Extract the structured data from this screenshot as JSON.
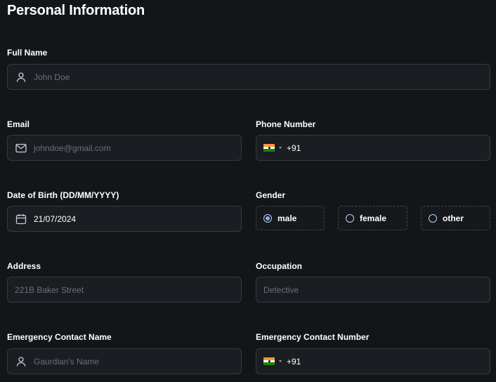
{
  "form": {
    "title": "Personal Information",
    "full_name": {
      "label": "Full Name",
      "placeholder": "John Doe"
    },
    "email": {
      "label": "Email",
      "placeholder": "johndoe@gmail.com"
    },
    "phone": {
      "label": "Phone Number",
      "value": "+91",
      "flag_icon": "india-flag-icon"
    },
    "dob": {
      "label": "Date of Birth (DD/MM/YYYY)",
      "value": "21/07/2024"
    },
    "gender": {
      "label": "Gender",
      "options": [
        {
          "label": "male",
          "selected": true
        },
        {
          "label": "female",
          "selected": false
        },
        {
          "label": "other",
          "selected": false
        }
      ]
    },
    "address": {
      "label": "Address",
      "placeholder": "221B Baker Street"
    },
    "occupation": {
      "label": "Occupation",
      "placeholder": "Detective"
    },
    "emergency_name": {
      "label": "Emergency Contact Name",
      "placeholder": "Gaurdian's Name"
    },
    "emergency_number": {
      "label": "Emergency Contact Number",
      "value": "+91",
      "flag_icon": "india-flag-icon"
    }
  },
  "colors": {
    "background": "#131619",
    "field_background": "#1a1d21",
    "field_border": "#363a3d",
    "placeholder": "#6b7177",
    "radio_accent": "#7fb2ff"
  }
}
